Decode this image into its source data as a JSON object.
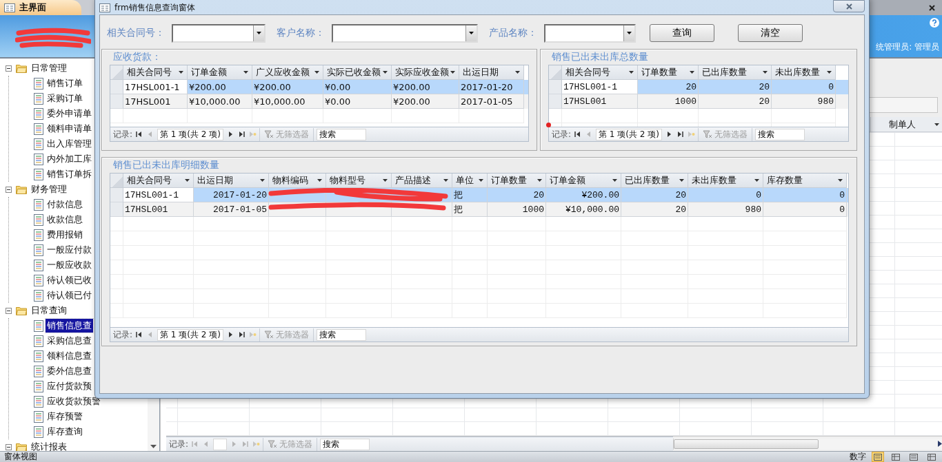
{
  "app_tab": {
    "title": "主界面"
  },
  "tree": [
    {
      "label": "日常管理",
      "expanded": true,
      "children": [
        {
          "label": "销售订单",
          "selected": false
        },
        {
          "label": "采购订单",
          "selected": false
        },
        {
          "label": "委外申请单",
          "selected": false
        },
        {
          "label": "领料申请单",
          "selected": false
        },
        {
          "label": "出入库管理",
          "selected": false
        },
        {
          "label": "内外加工库",
          "selected": false
        },
        {
          "label": "销售订单拆",
          "selected": false
        }
      ]
    },
    {
      "label": "财务管理",
      "expanded": true,
      "children": [
        {
          "label": "付款信息",
          "selected": false
        },
        {
          "label": "收款信息",
          "selected": false
        },
        {
          "label": "费用报销",
          "selected": false
        },
        {
          "label": "一般应付款",
          "selected": false
        },
        {
          "label": "一般应收款",
          "selected": false
        },
        {
          "label": "待认领已收",
          "selected": false
        },
        {
          "label": "待认领已付",
          "selected": false
        }
      ]
    },
    {
      "label": "日常查询",
      "expanded": true,
      "children": [
        {
          "label": "销售信息查",
          "selected": true
        },
        {
          "label": "采购信息查",
          "selected": false
        },
        {
          "label": "领料信息查",
          "selected": false
        },
        {
          "label": "委外信息查",
          "selected": false
        },
        {
          "label": "应付货款预",
          "selected": false
        },
        {
          "label": "应收货款预警",
          "selected": false
        },
        {
          "label": "库存预警",
          "selected": false
        },
        {
          "label": "库存查询",
          "selected": false
        }
      ]
    },
    {
      "label": "统计报表",
      "expanded": true
    }
  ],
  "header": {
    "user": "统管理员: 管理员"
  },
  "background_sheet": {
    "last_column": "制单人",
    "nav": {
      "label": "记录:",
      "filter": "无筛选器",
      "search": {
        "placeholder": "搜索"
      }
    }
  },
  "status_bar": {
    "left": "窗体视图",
    "right": "数字",
    "views": [
      {
        "selected": true
      },
      {
        "selected": false
      },
      {
        "selected": false
      },
      {
        "selected": false
      }
    ]
  },
  "dialog": {
    "title": "frm销售信息查询窗体",
    "filters": [
      {
        "label": "相关合同号："
      },
      {
        "label": "客户名称："
      },
      {
        "label": "产品名称："
      }
    ],
    "buttons": [
      "查询",
      "清空"
    ],
    "panels": [
      {
        "title": "应收货款：",
        "columns": [
          {
            "label": "相关合同号",
            "kind": "text"
          },
          {
            "label": "订单金额",
            "kind": "text"
          },
          {
            "label": "广义应收金额",
            "kind": "text"
          },
          {
            "label": "实际已收金额",
            "kind": "text"
          },
          {
            "label": "实际应收金额",
            "kind": "text"
          },
          {
            "label": "出运日期",
            "kind": "text"
          }
        ],
        "rows": [
          {
            "selected": true,
            "cells": [
              "17HSL001-1",
              "¥200.00",
              "¥200.00",
              "¥0.00",
              "¥200.00",
              "2017-01-20"
            ]
          },
          {
            "selected": false,
            "cells": [
              "17HSL001",
              "¥10,000.00",
              "¥10,000.00",
              "¥0.00",
              "¥200.00",
              "2017-01-05"
            ]
          }
        ],
        "nav": {
          "label": "记录:",
          "position": "第 1 项(共 2 项)",
          "filter": "无筛选器",
          "search": {
            "placeholder": "搜索"
          }
        }
      },
      {
        "title": "销售已出未出库总数量",
        "columns": [
          {
            "label": "相关合同号",
            "kind": "text"
          },
          {
            "label": "订单数量",
            "kind": "number"
          },
          {
            "label": "已出库数量",
            "kind": "number"
          },
          {
            "label": "未出库数量",
            "kind": "number"
          }
        ],
        "rows": [
          {
            "selected": true,
            "cells": [
              "17HSL001-1",
              "20",
              "20",
              "0"
            ]
          },
          {
            "selected": false,
            "cells": [
              "17HSL001",
              "1000",
              "20",
              "980"
            ]
          }
        ],
        "nav": {
          "label": "记录:",
          "position": "第 1 项(共 2 项)",
          "filter": "无筛选器",
          "search": {
            "placeholder": "搜索"
          }
        }
      },
      {
        "title": "销售已出未出库明细数量",
        "columns": [
          {
            "label": "相关合同号",
            "kind": "text"
          },
          {
            "label": "出运日期",
            "kind": "number"
          },
          {
            "label": "物料编码",
            "kind": "text"
          },
          {
            "label": "物料型号",
            "kind": "text"
          },
          {
            "label": "产品描述",
            "kind": "text"
          },
          {
            "label": "单位",
            "kind": "text"
          },
          {
            "label": "订单数量",
            "kind": "number"
          },
          {
            "label": "订单金额",
            "kind": "number"
          },
          {
            "label": "已出库数量",
            "kind": "number"
          },
          {
            "label": "未出库数量",
            "kind": "number"
          },
          {
            "label": "库存数量",
            "kind": "number"
          }
        ],
        "rows": [
          {
            "selected": true,
            "cells": [
              "17HSL001-1",
              "2017-01-20",
              null,
              null,
              null,
              "把",
              "20",
              "¥200.00",
              "20",
              "0",
              "0"
            ]
          },
          {
            "selected": false,
            "cells": [
              "17HSL001",
              "2017-01-05",
              null,
              null,
              null,
              "把",
              "1000",
              "¥10,000.00",
              "20",
              "980",
              "0"
            ]
          }
        ],
        "nav": {
          "label": "记录:",
          "position": "第 1 项(共 2 项)",
          "filter": "无筛选器",
          "search": {
            "placeholder": "搜索"
          }
        }
      }
    ]
  }
}
